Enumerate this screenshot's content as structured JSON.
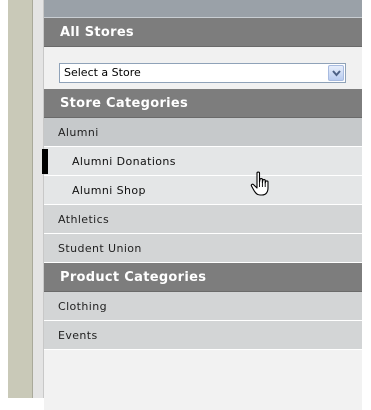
{
  "all_stores": {
    "header": "All Stores",
    "select_value": "Select a Store"
  },
  "store_categories": {
    "header": "Store Categories",
    "items": [
      {
        "label": "Alumni"
      },
      {
        "label": "Alumni Donations"
      },
      {
        "label": "Alumni Shop"
      },
      {
        "label": "Athletics"
      },
      {
        "label": "Student Union"
      }
    ]
  },
  "product_categories": {
    "header": "Product Categories",
    "items": [
      {
        "label": "Clothing"
      },
      {
        "label": "Events"
      }
    ]
  },
  "icons": {
    "dropdown": "chevron-down-icon",
    "cursor": "hand-pointer-icon"
  },
  "colors": {
    "header_bg": "#7d7d7d",
    "item_bg": "#c6c9cb",
    "sub_item_bg": "#e4e6e7",
    "active_marker": "#000000"
  }
}
